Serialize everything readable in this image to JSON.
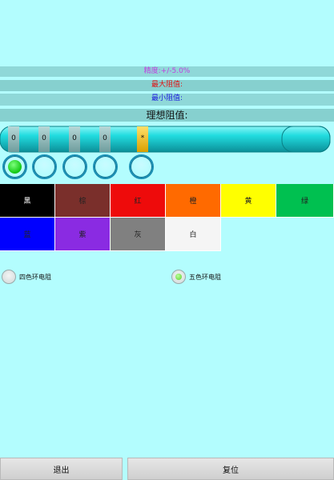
{
  "info": {
    "precision": "精度:+/-5.0%",
    "precision_color": "#c040e0",
    "max": "最大阻值:",
    "max_color": "#e01010",
    "min": "最小阻值:",
    "min_color": "#1c1cdc",
    "ideal": "理想阻值:"
  },
  "resistor": {
    "band_labels": [
      "0",
      "0",
      "0",
      "0",
      "*"
    ],
    "body_color": "#22dde0",
    "band_color": "#8fbcbc",
    "selected_band_color": "#f4c20a"
  },
  "band_selectors": [
    {
      "name": "band-1",
      "active": true
    },
    {
      "name": "band-2",
      "active": false
    },
    {
      "name": "band-3",
      "active": false
    },
    {
      "name": "band-4",
      "active": false
    },
    {
      "name": "band-5",
      "active": false
    }
  ],
  "colors": [
    {
      "label": "黑",
      "bg": "#000000",
      "fg": "#ffffff"
    },
    {
      "label": "棕",
      "bg": "#7a2f2b",
      "fg": "#222222"
    },
    {
      "label": "红",
      "bg": "#ee0b0b",
      "fg": "#222222"
    },
    {
      "label": "橙",
      "bg": "#ff6a00",
      "fg": "#222222"
    },
    {
      "label": "黄",
      "bg": "#ffff00",
      "fg": "#222222"
    },
    {
      "label": "绿",
      "bg": "#00c050",
      "fg": "#222222"
    },
    {
      "label": "蓝",
      "bg": "#0000ff",
      "fg": "#222222"
    },
    {
      "label": "紫",
      "bg": "#8a2be2",
      "fg": "#222222"
    },
    {
      "label": "灰",
      "bg": "#808080",
      "fg": "#222222"
    },
    {
      "label": "白",
      "bg": "#f5f5f5",
      "fg": "#222222"
    }
  ],
  "mode": {
    "four_band": "四色环电阻",
    "five_band": "五色环电阻",
    "selected": "five_band"
  },
  "buttons": {
    "exit": "退出",
    "reset": "复位"
  }
}
